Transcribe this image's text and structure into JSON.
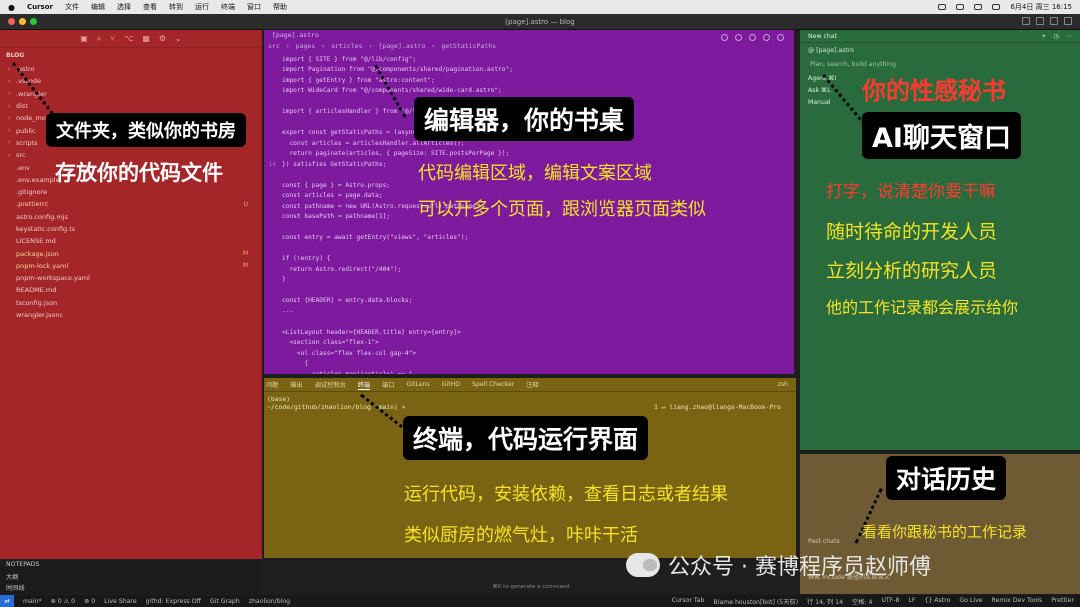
{
  "menubar": {
    "app": "Cursor",
    "menus": [
      "文件",
      "编辑",
      "选择",
      "查看",
      "转到",
      "运行",
      "终端",
      "窗口",
      "帮助"
    ],
    "clock": "6月4日 周三  16:15"
  },
  "window": {
    "title": "[page].astro — blog"
  },
  "sidebar": {
    "header": "BLOG",
    "files": [
      {
        "name": ".astro",
        "folder": true,
        "status": ""
      },
      {
        "name": ".vscode",
        "folder": true,
        "status": ""
      },
      {
        "name": ".wrangler",
        "folder": true,
        "status": ""
      },
      {
        "name": "dist",
        "folder": true,
        "status": ""
      },
      {
        "name": "node_modules",
        "folder": true,
        "status": ""
      },
      {
        "name": "public",
        "folder": true,
        "status": ""
      },
      {
        "name": "scripts",
        "folder": true,
        "status": ""
      },
      {
        "name": "src",
        "folder": true,
        "status": ""
      },
      {
        "name": ".env",
        "folder": false,
        "status": ""
      },
      {
        "name": ".env.example",
        "folder": false,
        "status": ""
      },
      {
        "name": ".gitignore",
        "folder": false,
        "status": ""
      },
      {
        "name": ".prettierrc",
        "folder": false,
        "status": "U"
      },
      {
        "name": "astro.config.mjs",
        "folder": false,
        "status": ""
      },
      {
        "name": "keystatic.config.ts",
        "folder": false,
        "status": ""
      },
      {
        "name": "LICENSE.md",
        "folder": false,
        "status": ""
      },
      {
        "name": "package.json",
        "folder": false,
        "status": "M"
      },
      {
        "name": "pnpm-lock.yaml",
        "folder": false,
        "status": "M"
      },
      {
        "name": "pnpm-workspace.yaml",
        "folder": false,
        "status": ""
      },
      {
        "name": "README.md",
        "folder": false,
        "status": ""
      },
      {
        "name": "tsconfig.json",
        "folder": false,
        "status": ""
      },
      {
        "name": "wrangler.jsonc",
        "folder": false,
        "status": ""
      }
    ]
  },
  "outline": [
    "NOTEPADS",
    "大纲",
    "时间线"
  ],
  "editor": {
    "tab": "[page].astro",
    "breadcrumb": [
      "src",
      "pages",
      "articles",
      "[page].astro",
      "getStaticPaths"
    ],
    "lines": [
      {
        "n": "",
        "t": "import { SITE } from \"@/lib/config\";"
      },
      {
        "n": "",
        "t": "import Pagination from \"@/components/shared/pagination.astro\";"
      },
      {
        "n": "",
        "t": "import { getEntry } from \"astro:content\";"
      },
      {
        "n": "",
        "t": "import WideCard from \"@/components/shared/wide-card.astro\";"
      },
      {
        "n": "",
        "t": ""
      },
      {
        "n": "",
        "t": "import { articlesHandler } from \"@/lib/handlers\";"
      },
      {
        "n": "",
        "t": ""
      },
      {
        "n": "",
        "t": "export const getStaticPaths = (async ({ paginate }) => {"
      },
      {
        "n": "",
        "t": "  const articles = articlesHandler.allArticles();"
      },
      {
        "n": "",
        "t": "  return paginate(articles, { pageSize: SITE.postsPerPage });"
      },
      {
        "n": "14",
        "t": "}) satisfies GetStaticPaths;"
      },
      {
        "n": "",
        "t": ""
      },
      {
        "n": "",
        "t": "const { page } = Astro.props;"
      },
      {
        "n": "",
        "t": "const articles = page.data;"
      },
      {
        "n": "",
        "t": "const pathname = new URL(Astro.request.url).pathname;"
      },
      {
        "n": "",
        "t": "const basePath = pathname[1];"
      },
      {
        "n": "",
        "t": ""
      },
      {
        "n": "",
        "t": "const entry = await getEntry(\"views\", \"articles\");"
      },
      {
        "n": "",
        "t": ""
      },
      {
        "n": "",
        "t": "if (!entry) {"
      },
      {
        "n": "",
        "t": "  return Astro.redirect(\"/404\");"
      },
      {
        "n": "",
        "t": "}"
      },
      {
        "n": "",
        "t": ""
      },
      {
        "n": "",
        "t": "const {HEADER} = entry.data.blocks;"
      },
      {
        "n": "",
        "t": "---"
      },
      {
        "n": "",
        "t": ""
      },
      {
        "n": "",
        "t": "<ListLayout header={HEADER.title} entry={entry}>"
      },
      {
        "n": "",
        "t": "  <section class=\"flex-1\">"
      },
      {
        "n": "",
        "t": "    <ul class=\"flex flex-col gap-4\">"
      },
      {
        "n": "",
        "t": "      {"
      },
      {
        "n": "",
        "t": "        articles.map((article) => ("
      }
    ]
  },
  "terminal": {
    "tabs": [
      "问题",
      "输出",
      "调试控制台",
      "终端",
      "端口",
      "GitLens",
      "GitHD",
      "Spell Checker",
      "注释"
    ],
    "active_tab": "终端",
    "shell": "zsh",
    "lines": [
      "(base)",
      "~/code/github/zhaolion/blog (main) »"
    ],
    "prompt_right": "1 ↵ liang.zhao@liangs-MacBook-Pro"
  },
  "chat": {
    "title": "New chat",
    "context_file": "[page].astro",
    "placeholder": "Plan, search, build anything",
    "modes": [
      "Agent ⌘I",
      "Ask ⌘L",
      "Manual"
    ]
  },
  "history": {
    "label": "Past chats",
    "item": "探索 include 路径的实际含义"
  },
  "bottom": {
    "generate_hint": "⌘K to generate a command"
  },
  "statusbar": {
    "left": [
      "main*",
      "⊗ 0 ⚠ 0",
      "⊗ 0",
      "Live Share",
      "githd: Express Off",
      "Git Graph",
      "zhaolion/blog"
    ],
    "right": [
      "Cursor Tab",
      "Blame houston[bot] (5天前)",
      "行 14, 列 14",
      "空格: 4",
      "UTF-8",
      "LF",
      "{} Astro",
      "Go Live",
      "Remix Dev Tools",
      "Prettier"
    ]
  },
  "annotations": {
    "folder_title": "文件夹，类似你的书房",
    "folder_desc": "存放你的代码文件",
    "editor_title": "编辑器，你的书桌",
    "editor_desc1": "代码编辑区域，编辑文案区域",
    "editor_desc2": "可以开多个页面，跟浏览器页面类似",
    "chat_tag": "你的性感秘书",
    "chat_title": "AI聊天窗口",
    "chat_desc1": "打字，说清楚你要干嘛",
    "chat_desc2": "随时待命的开发人员",
    "chat_desc3": "立刻分析的研究人员",
    "chat_desc4": "他的工作记录都会展示给你",
    "term_title": "终端，代码运行界面",
    "term_desc1": "运行代码，安装依赖，查看日志或者结果",
    "term_desc2": "类似厨房的燃气灶，咔咔干活",
    "history_title": "对话历史",
    "history_desc": "看看你跟秘书的工作记录",
    "watermark": "公众号 · 赛博程序员赵师傅"
  }
}
